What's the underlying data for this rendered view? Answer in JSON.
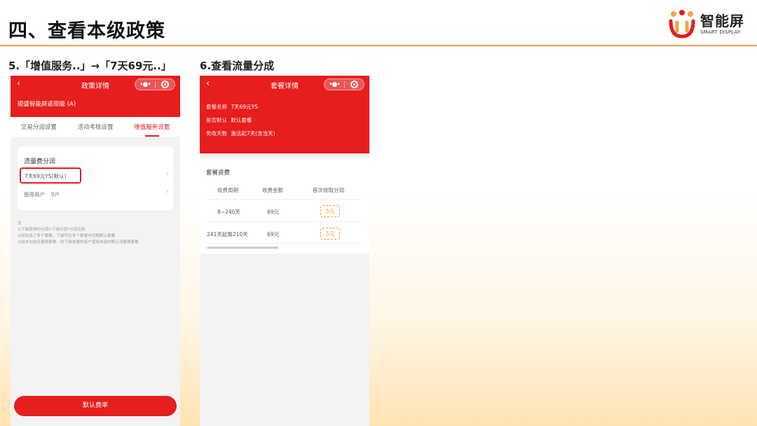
{
  "header": {
    "title": "四、查看本级政策",
    "logo_cn": "智能屏",
    "logo_en": "SMART DISPLAY"
  },
  "captions": {
    "step5": "5.「增值服务..」→「7天69元..」",
    "step6": "6.查看流量分成"
  },
  "colors": {
    "brand_red": "#e61e1e",
    "accent_orange": "#f0a640",
    "tag_orange": "#f09a30"
  },
  "phone1": {
    "nav_title": "政策详情",
    "back_icon": "‹",
    "capsule_dots": "•●•",
    "policy_name": "银盛智能屏返现版 (A)",
    "tabs": [
      {
        "label": "交易分润设置",
        "active": false
      },
      {
        "label": "活动考核设置",
        "active": false
      },
      {
        "label": "增值服务设置",
        "active": true
      }
    ],
    "card": {
      "title": "流量费分润",
      "package": "7天69元YS(默认)",
      "merchants_label": "使用商户",
      "merchants_value": "0户",
      "chevron": "›"
    },
    "notes": [
      "注",
      "①下级获得的分润=下级分润*分润比例",
      "②如勾选了多个套餐，下级可在多个套餐中切换默认套餐",
      "③如未勾选流量费套餐，则下级发展的商户使用本级的默认流量费套餐"
    ],
    "bottom_button": "默认费率"
  },
  "phone2": {
    "nav_title": "套餐详情",
    "back_icon": "‹",
    "capsule_dots": "•●•",
    "info": [
      {
        "key": "套餐名称",
        "value": "7天69元YS"
      },
      {
        "key": "是否默认",
        "value": "默认套餐"
      },
      {
        "key": "免收天数",
        "value": "激活起7天(含当天)"
      }
    ],
    "fee_title": "套餐资费",
    "columns": [
      "收费周期",
      "收费金额",
      "首次收取分润"
    ],
    "rows": [
      {
        "period": "8~240天",
        "amount": "69元",
        "share": "5元"
      },
      {
        "period": "241天起每210天",
        "amount": "69元",
        "share": "5元"
      }
    ]
  }
}
